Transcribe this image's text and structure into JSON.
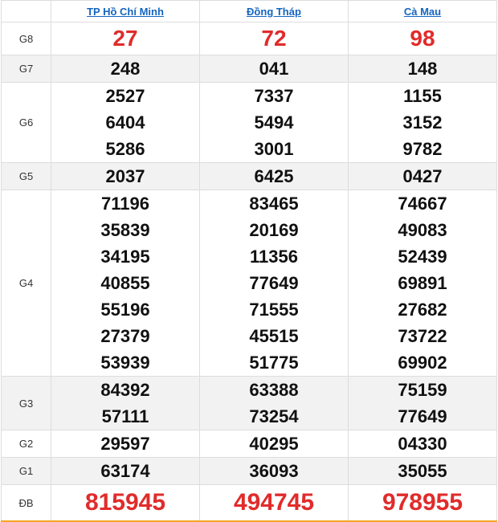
{
  "provinces": [
    "TP Hồ Chí Minh",
    "Đồng Tháp",
    "Cà Mau"
  ],
  "colors": {
    "link": "#1565c0",
    "highlight": "#e12b2b",
    "row_shade": "#f2f2f2",
    "bottom_rule": "#f5a623"
  },
  "prizes": {
    "g8": {
      "label": "G8",
      "values": [
        [
          "27"
        ],
        [
          "72"
        ],
        [
          "98"
        ]
      ]
    },
    "g7": {
      "label": "G7",
      "values": [
        [
          "248"
        ],
        [
          "041"
        ],
        [
          "148"
        ]
      ]
    },
    "g6": {
      "label": "G6",
      "values": [
        [
          "2527",
          "6404",
          "5286"
        ],
        [
          "7337",
          "5494",
          "3001"
        ],
        [
          "1155",
          "3152",
          "9782"
        ]
      ]
    },
    "g5": {
      "label": "G5",
      "values": [
        [
          "2037"
        ],
        [
          "6425"
        ],
        [
          "0427"
        ]
      ]
    },
    "g4": {
      "label": "G4",
      "values": [
        [
          "71196",
          "35839",
          "34195",
          "40855",
          "55196",
          "27379",
          "53939"
        ],
        [
          "83465",
          "20169",
          "11356",
          "77649",
          "71555",
          "45515",
          "51775"
        ],
        [
          "74667",
          "49083",
          "52439",
          "69891",
          "27682",
          "73722",
          "69902"
        ]
      ]
    },
    "g3": {
      "label": "G3",
      "values": [
        [
          "84392",
          "57111"
        ],
        [
          "63388",
          "73254"
        ],
        [
          "75159",
          "77649"
        ]
      ]
    },
    "g2": {
      "label": "G2",
      "values": [
        [
          "29597"
        ],
        [
          "40295"
        ],
        [
          "04330"
        ]
      ]
    },
    "g1": {
      "label": "G1",
      "values": [
        [
          "63174"
        ],
        [
          "36093"
        ],
        [
          "35055"
        ]
      ]
    },
    "db": {
      "label": "ĐB",
      "values": [
        [
          "815945"
        ],
        [
          "494745"
        ],
        [
          "978955"
        ]
      ]
    }
  }
}
